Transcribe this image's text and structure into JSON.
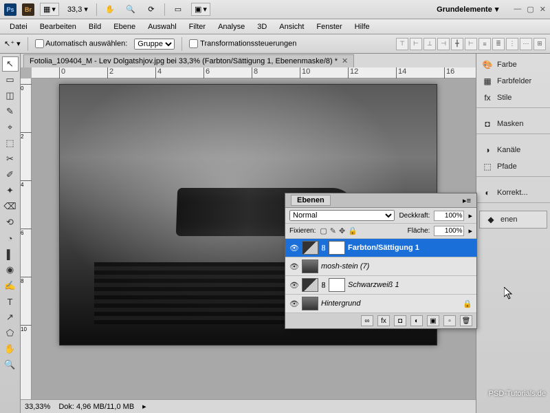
{
  "titlebar": {
    "ps": "Ps",
    "br": "Br",
    "zoom_value": "33,3",
    "workspace_label": "Grundelemente"
  },
  "menu": {
    "items": [
      "Datei",
      "Bearbeiten",
      "Bild",
      "Ebene",
      "Auswahl",
      "Filter",
      "Analyse",
      "3D",
      "Ansicht",
      "Fenster",
      "Hilfe"
    ]
  },
  "options": {
    "auto_select_label": "Automatisch auswählen:",
    "group_select_value": "Gruppe",
    "transform_controls_label": "Transformationssteuerungen"
  },
  "document": {
    "tab_title": "Fotolia_109404_M - Lev Dolgatshjov.jpg bei 33,3% (Farbton/Sättigung 1, Ebenenmaske/8) *"
  },
  "ruler": {
    "h_ticks": [
      "0",
      "2",
      "4",
      "6",
      "8",
      "10",
      "12",
      "14",
      "16"
    ],
    "v_ticks": [
      "0",
      "2",
      "4",
      "6",
      "8",
      "10"
    ]
  },
  "status": {
    "zoom": "33,33%",
    "doc_info": "Dok: 4,96 MB/11,0 MB"
  },
  "side_panels": {
    "items": [
      {
        "icon": "🎨",
        "label": "Farbe"
      },
      {
        "icon": "▦",
        "label": "Farbfelder"
      },
      {
        "icon": "fx",
        "label": "Stile"
      },
      {
        "icon": "◘",
        "label": "Masken"
      },
      {
        "icon": "◑",
        "label": "Kanäle"
      },
      {
        "icon": "⬚",
        "label": "Pfade"
      },
      {
        "icon": "◐",
        "label": "Korrekt..."
      },
      {
        "icon": "◆",
        "label": "enen"
      }
    ]
  },
  "layers_panel": {
    "title": "Ebenen",
    "blend_mode": "Normal",
    "opacity_label": "Deckkraft:",
    "opacity_value": "100%",
    "lock_label": "Fixieren:",
    "fill_label": "Fläche:",
    "fill_value": "100%",
    "layers": [
      {
        "name": "Farbton/Sättigung 1",
        "selected": true,
        "type": "adj",
        "locked": false
      },
      {
        "name": "mosh-stein (7)",
        "selected": false,
        "type": "img",
        "locked": false
      },
      {
        "name": "Schwarzweiß 1",
        "selected": false,
        "type": "adj",
        "locked": false
      },
      {
        "name": "Hintergrund",
        "selected": false,
        "type": "bg",
        "locked": true
      }
    ]
  },
  "toolbox": {
    "tools": [
      "↖",
      "▭",
      "◫",
      "✎",
      "⌖",
      "⬚",
      "✂",
      "✐",
      "✦",
      "⌫",
      "⟲",
      "◔",
      "▌",
      "◉",
      "✍",
      "⬠",
      "T",
      "↗",
      "✋",
      "🔍"
    ]
  },
  "watermark": "PSD-Tutorials.de"
}
